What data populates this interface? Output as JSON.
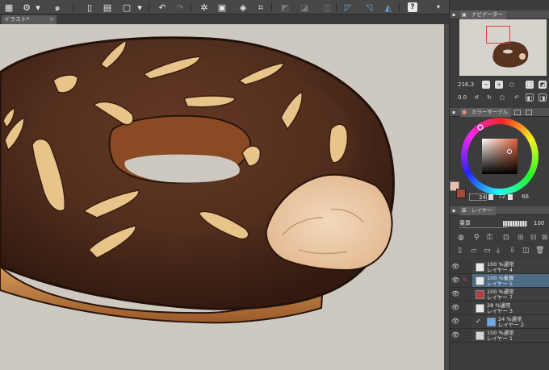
{
  "toolbar": {
    "icons": [
      "grid-icon",
      "settings-icon",
      "spiral-logo-icon",
      "new-file-icon",
      "open-file-icon",
      "save-icon",
      "undo-icon",
      "redo-icon",
      "transform-icon",
      "clear-icon",
      "crop-icon",
      "snap-icon",
      "ruler-icon",
      "help-icon"
    ],
    "help_label": "?"
  },
  "tab": {
    "label": "イラスト*",
    "close": "×"
  },
  "navigator": {
    "title": "ナビゲーター",
    "zoom": "216.3",
    "rotation": "0.0"
  },
  "color_circle": {
    "title": "カラーサークル",
    "h": "24",
    "s": "72",
    "v": "66",
    "main_color": "#a8473b",
    "sub_color": "#e8c0b0"
  },
  "layers": {
    "title": "レイヤー",
    "blend_mode": "乗算",
    "opacity": "100",
    "items": [
      {
        "line1": "100 %通常",
        "line2": "レイヤー 4",
        "selected": false
      },
      {
        "line1": "100 %乗算",
        "line2": "レイヤー 5",
        "selected": true
      },
      {
        "line1": "100 %通常",
        "line2": "レイヤー 7",
        "selected": false
      },
      {
        "line1": "28 %通常",
        "line2": "レイヤー 3",
        "selected": false
      },
      {
        "line1": "24 %通常",
        "line2": "レイヤー 2",
        "selected": false
      },
      {
        "line1": "100 %通常",
        "line2": "レイヤー 1",
        "selected": false
      }
    ]
  },
  "colors": {
    "canvas_bg": "#cdc9c1",
    "donut_chocolate": "#4a2a1c",
    "donut_dough": "#c98a4c"
  }
}
